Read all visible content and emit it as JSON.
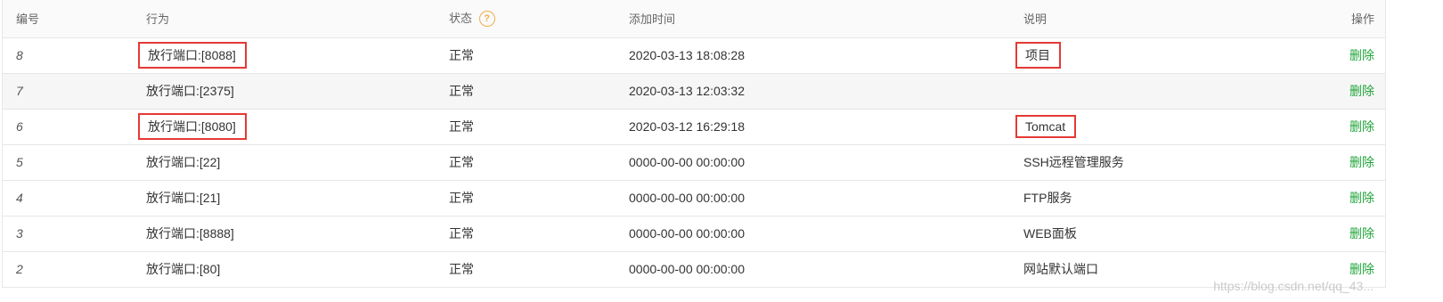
{
  "header": {
    "id": "编号",
    "action": "行为",
    "status": "状态",
    "time": "添加时间",
    "desc": "说明",
    "op": "操作",
    "help_glyph": "?"
  },
  "rows": [
    {
      "id": "8",
      "action": "放行端口:[8088]",
      "status": "正常",
      "time": "2020-03-13 18:08:28",
      "desc": "项目",
      "op": "删除"
    },
    {
      "id": "7",
      "action": "放行端口:[2375]",
      "status": "正常",
      "time": "2020-03-13 12:03:32",
      "desc": "",
      "op": "删除"
    },
    {
      "id": "6",
      "action": "放行端口:[8080]",
      "status": "正常",
      "time": "2020-03-12 16:29:18",
      "desc": "Tomcat",
      "op": "删除"
    },
    {
      "id": "5",
      "action": "放行端口:[22]",
      "status": "正常",
      "time": "0000-00-00 00:00:00",
      "desc": "SSH远程管理服务",
      "op": "删除"
    },
    {
      "id": "4",
      "action": "放行端口:[21]",
      "status": "正常",
      "time": "0000-00-00 00:00:00",
      "desc": "FTP服务",
      "op": "删除"
    },
    {
      "id": "3",
      "action": "放行端口:[8888]",
      "status": "正常",
      "time": "0000-00-00 00:00:00",
      "desc": "WEB面板",
      "op": "删除"
    },
    {
      "id": "2",
      "action": "放行端口:[80]",
      "status": "正常",
      "time": "0000-00-00 00:00:00",
      "desc": "网站默认端口",
      "op": "删除"
    }
  ],
  "watermark": "https://blog.csdn.net/qq_43...",
  "colors": {
    "delete_link": "#20a53a",
    "highlight_box": "#e53935",
    "help_icon": "#f0ad4e",
    "alt_row": "#f6f6f6"
  }
}
